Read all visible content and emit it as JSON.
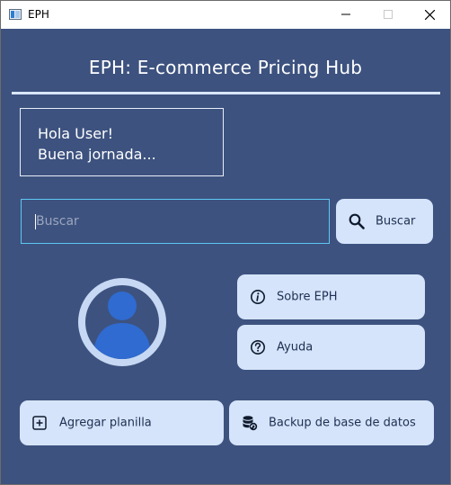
{
  "window": {
    "title": "EPH",
    "controls": [
      "minimize-icon",
      "maximize-icon",
      "close-icon"
    ]
  },
  "header": {
    "title": "EPH: E-commerce Pricing Hub"
  },
  "greeting": {
    "line1": "Hola User!",
    "line2": "Buena jornada..."
  },
  "search": {
    "placeholder": "Buscar",
    "value": "",
    "button_label": "Buscar",
    "button_icon": "search-icon"
  },
  "actions": {
    "about": {
      "label": "Sobre EPH",
      "icon": "info-icon"
    },
    "help": {
      "label": "Ayuda",
      "icon": "help-icon"
    },
    "add_sheet": {
      "label": "Agregar planilla",
      "icon": "plus-square-icon"
    },
    "backup": {
      "label": "Backup de base de datos",
      "icon": "database-backup-icon"
    }
  },
  "colors": {
    "background": "#3d527f",
    "button": "#d5e4fa",
    "accent_border": "#5ec7f2",
    "avatar": "#2f6bd0"
  }
}
